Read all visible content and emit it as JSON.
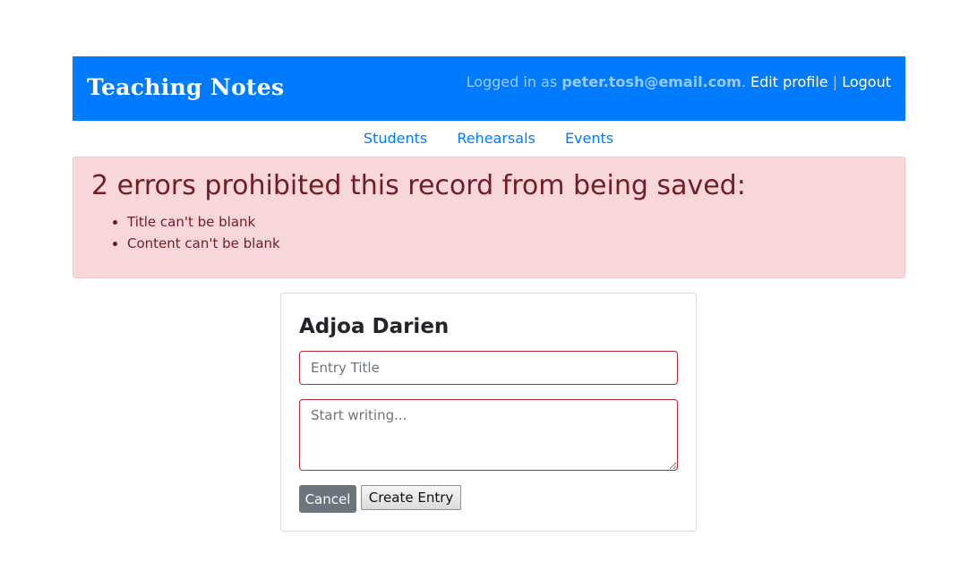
{
  "header": {
    "brand": "Teaching Notes",
    "logged_in_prefix": "Logged in as ",
    "email": "peter.tosh@email.com",
    "period": ".",
    "edit_profile": "Edit profile",
    "separator": "|",
    "logout": "Logout"
  },
  "nav": {
    "items": [
      {
        "label": "Students"
      },
      {
        "label": "Rehearsals"
      },
      {
        "label": "Events"
      }
    ]
  },
  "errors": {
    "heading": "2 errors prohibited this record from being saved:",
    "items": [
      "Title can't be blank",
      "Content can't be blank"
    ]
  },
  "form": {
    "student_name": "Adjoa Darien",
    "title_value": "",
    "title_placeholder": "Entry Title",
    "content_value": "",
    "content_placeholder": "Start writing...",
    "cancel_label": "Cancel",
    "submit_label": "Create Entry"
  },
  "colors": {
    "header_bg": "#007bff",
    "link": "#007bff",
    "alert_bg": "#f8d7da",
    "alert_text": "#721c24",
    "invalid_border": "#b02a37",
    "cancel_bg": "#6c757d"
  }
}
